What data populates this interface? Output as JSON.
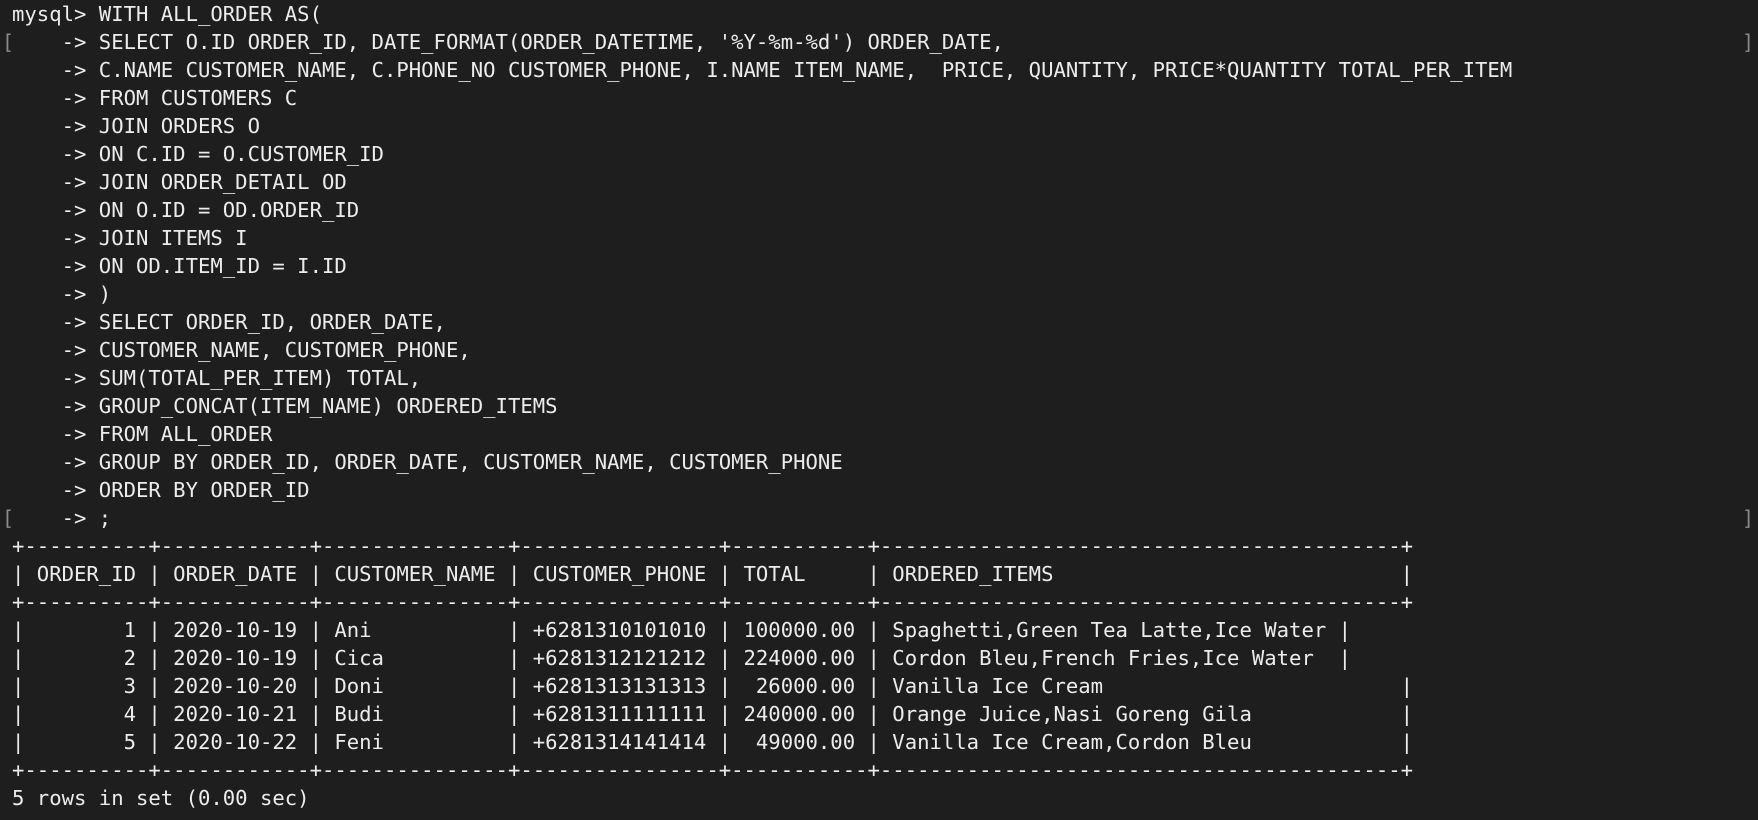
{
  "terminal": {
    "prompt_lines": [
      "mysql> WITH ALL_ORDER AS(",
      "    -> SELECT O.ID ORDER_ID, DATE_FORMAT(ORDER_DATETIME, '%Y-%m-%d') ORDER_DATE,",
      "    -> C.NAME CUSTOMER_NAME, C.PHONE_NO CUSTOMER_PHONE, I.NAME ITEM_NAME,  PRICE, QUANTITY, PRICE*QUANTITY TOTAL_PER_ITEM",
      "    -> FROM CUSTOMERS C",
      "    -> JOIN ORDERS O",
      "    -> ON C.ID = O.CUSTOMER_ID",
      "    -> JOIN ORDER_DETAIL OD",
      "    -> ON O.ID = OD.ORDER_ID",
      "    -> JOIN ITEMS I",
      "    -> ON OD.ITEM_ID = I.ID",
      "    -> )",
      "    -> SELECT ORDER_ID, ORDER_DATE,",
      "    -> CUSTOMER_NAME, CUSTOMER_PHONE,",
      "    -> SUM(TOTAL_PER_ITEM) TOTAL,",
      "    -> GROUP_CONCAT(ITEM_NAME) ORDERED_ITEMS",
      "    -> FROM ALL_ORDER",
      "    -> GROUP BY ORDER_ID, ORDER_DATE, CUSTOMER_NAME, CUSTOMER_PHONE",
      "    -> ORDER BY ORDER_ID",
      "    -> ;"
    ],
    "bracket_left": "[",
    "bracket_right": "]",
    "table": {
      "border": "+----------+------------+---------------+----------------+-----------+------------------------------------------+",
      "header": "| ORDER_ID | ORDER_DATE | CUSTOMER_NAME | CUSTOMER_PHONE | TOTAL     | ORDERED_ITEMS                            |",
      "rows": [
        "|        1 | 2020-10-19 | Ani           | +6281310101010 | 100000.00 | Spaghetti,Green Tea Latte,Ice Water |",
        "|        2 | 2020-10-19 | Cica          | +6281312121212 | 224000.00 | Cordon Bleu,French Fries,Ice Water  |",
        "|        3 | 2020-10-20 | Doni          | +6281313131313 |  26000.00 | Vanilla Ice Cream                        |",
        "|        4 | 2020-10-21 | Budi          | +6281311111111 | 240000.00 | Orange Juice,Nasi Goreng Gila            |",
        "|        5 | 2020-10-22 | Feni          | +6281314141414 |  49000.00 | Vanilla Ice Cream,Cordon Bleu            |"
      ]
    },
    "result_summary": "5 rows in set (0.00 sec)",
    "colors": {
      "background": "#1e1e1e",
      "text": "#ececec",
      "bracket": "#8a8a8a"
    }
  }
}
